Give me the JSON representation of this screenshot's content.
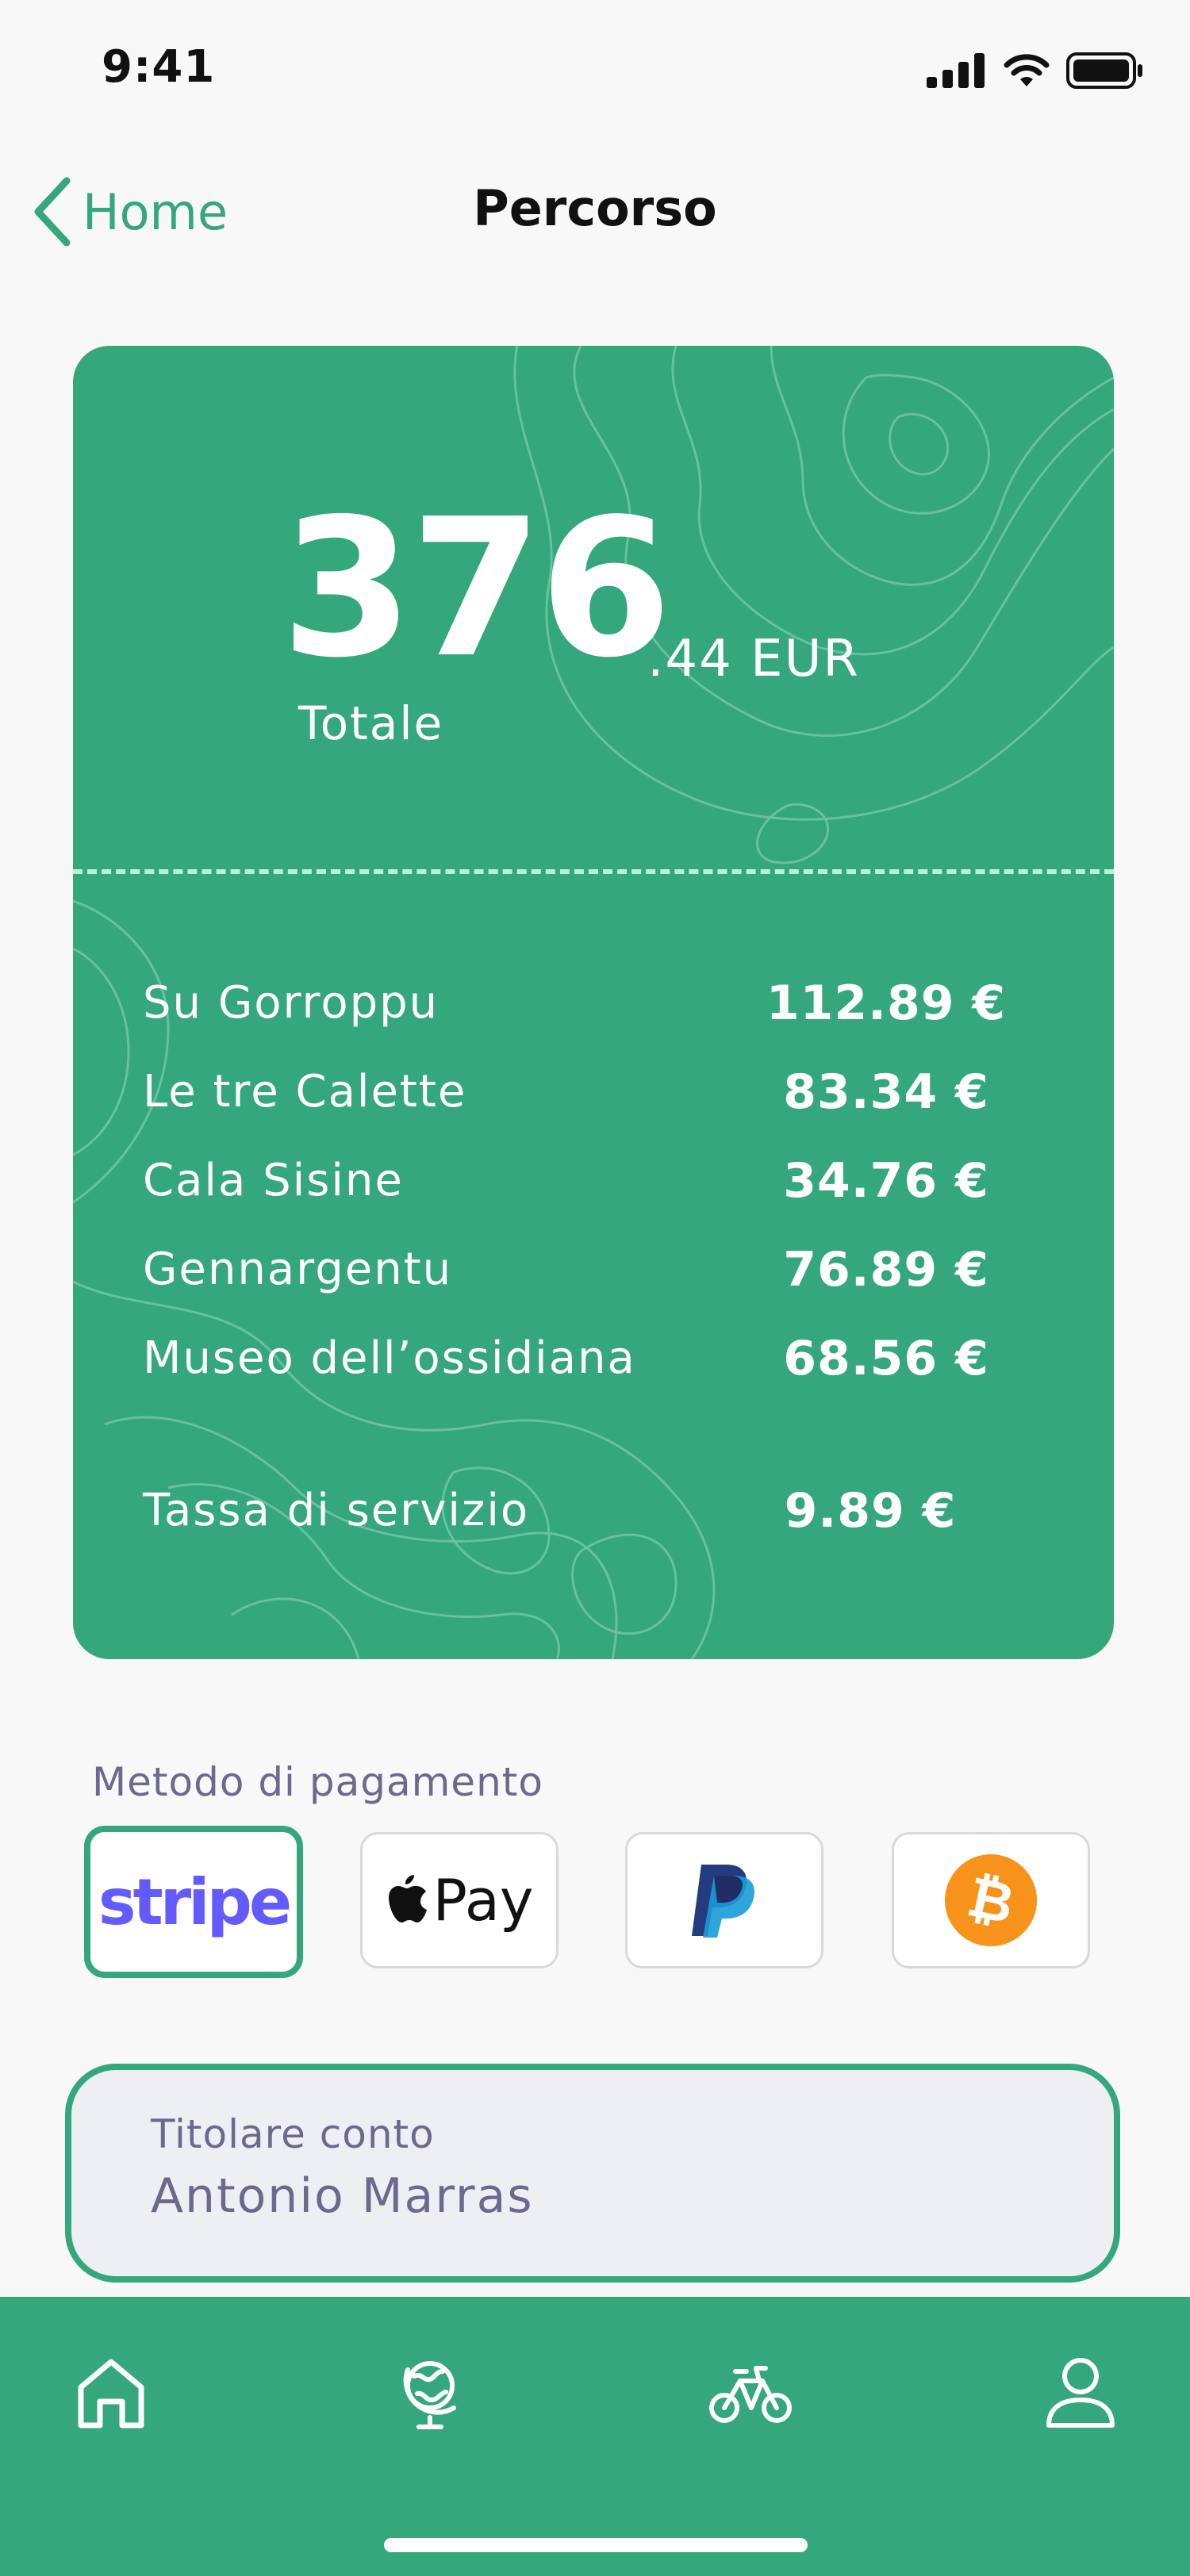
{
  "status_bar": {
    "time": "9:41",
    "icons": [
      "signal-icon",
      "wifi-icon",
      "battery-icon"
    ]
  },
  "nav": {
    "back_label": "Home",
    "title": "Percorso"
  },
  "summary": {
    "total_integer": "376",
    "total_decimal": ".44 EUR",
    "total_label": "Totale",
    "items": [
      {
        "name": "Su Gorroppu",
        "price": "112.89 €"
      },
      {
        "name": "Le tre Calette",
        "price": "83.34 €"
      },
      {
        "name": "Cala Sisine",
        "price": "34.76 €"
      },
      {
        "name": "Gennargentu",
        "price": "76.89 €"
      },
      {
        "name": "Museo dell’ossidiana",
        "price": "68.56 €"
      }
    ],
    "fee": {
      "name": "Tassa di servizio",
      "price": "9.89 €"
    }
  },
  "payment": {
    "label": "Metodo di pagamento",
    "methods": [
      {
        "name": "stripe",
        "text": "stripe",
        "selected": true
      },
      {
        "name": "apple-pay",
        "text": "Pay",
        "selected": false
      },
      {
        "name": "paypal",
        "icon": "paypal-logo",
        "selected": false
      },
      {
        "name": "bitcoin",
        "icon": "bitcoin-logo",
        "selected": false
      }
    ]
  },
  "account": {
    "label": "Titolare conto",
    "value": "Antonio Marras"
  },
  "tabbar": {
    "tabs": [
      "home-icon",
      "globe-icon",
      "bike-icon",
      "user-icon"
    ],
    "active": "home-icon"
  },
  "colors": {
    "accent": "#34a77c",
    "stripe": "#635bff",
    "bitcoin": "#f7931a",
    "muted_text": "#6b6a8e"
  }
}
